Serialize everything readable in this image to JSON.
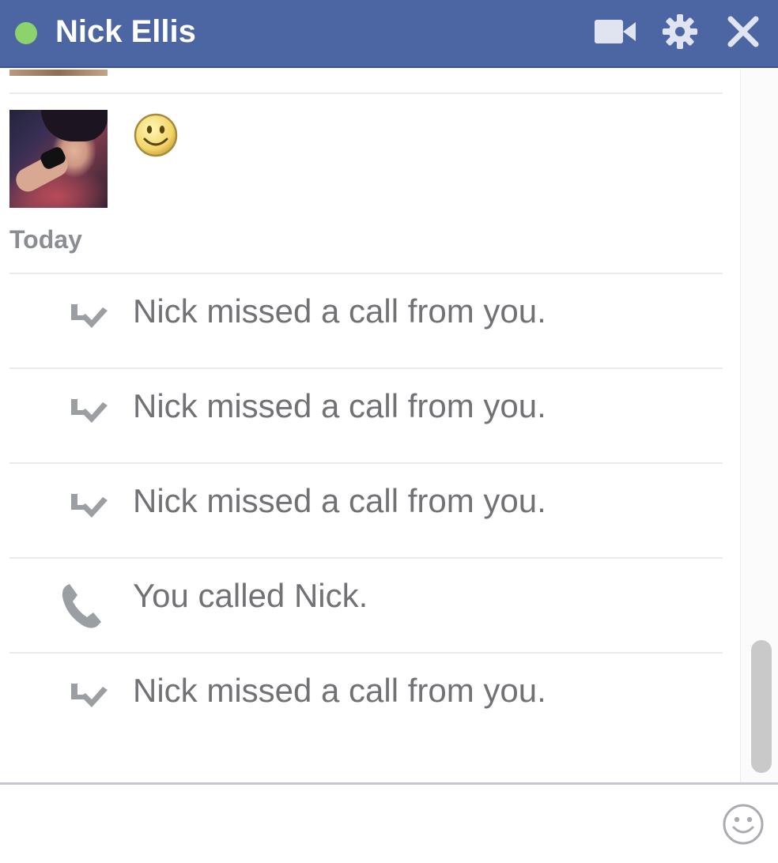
{
  "header": {
    "contact_name": "Nick Ellis",
    "status": "online",
    "status_color": "#8dd36b",
    "bar_color": "#4c66a4",
    "icons": [
      "video-camera-icon",
      "gear-icon",
      "close-icon"
    ]
  },
  "conversation": {
    "sticker_message": {
      "icon": "smiley-emoticon-icon"
    },
    "date_separator": "Today",
    "call_log": [
      {
        "icon": "missed-call-icon",
        "text": "Nick missed a call from you."
      },
      {
        "icon": "missed-call-icon",
        "text": "Nick missed a call from you."
      },
      {
        "icon": "missed-call-icon",
        "text": "Nick missed a call from you."
      },
      {
        "icon": "phone-icon",
        "text": "You called Nick."
      },
      {
        "icon": "missed-call-icon",
        "text": "Nick missed a call from you."
      }
    ]
  },
  "composer": {
    "value": "",
    "placeholder": "",
    "emoji_icon": "emoji-picker-icon"
  }
}
